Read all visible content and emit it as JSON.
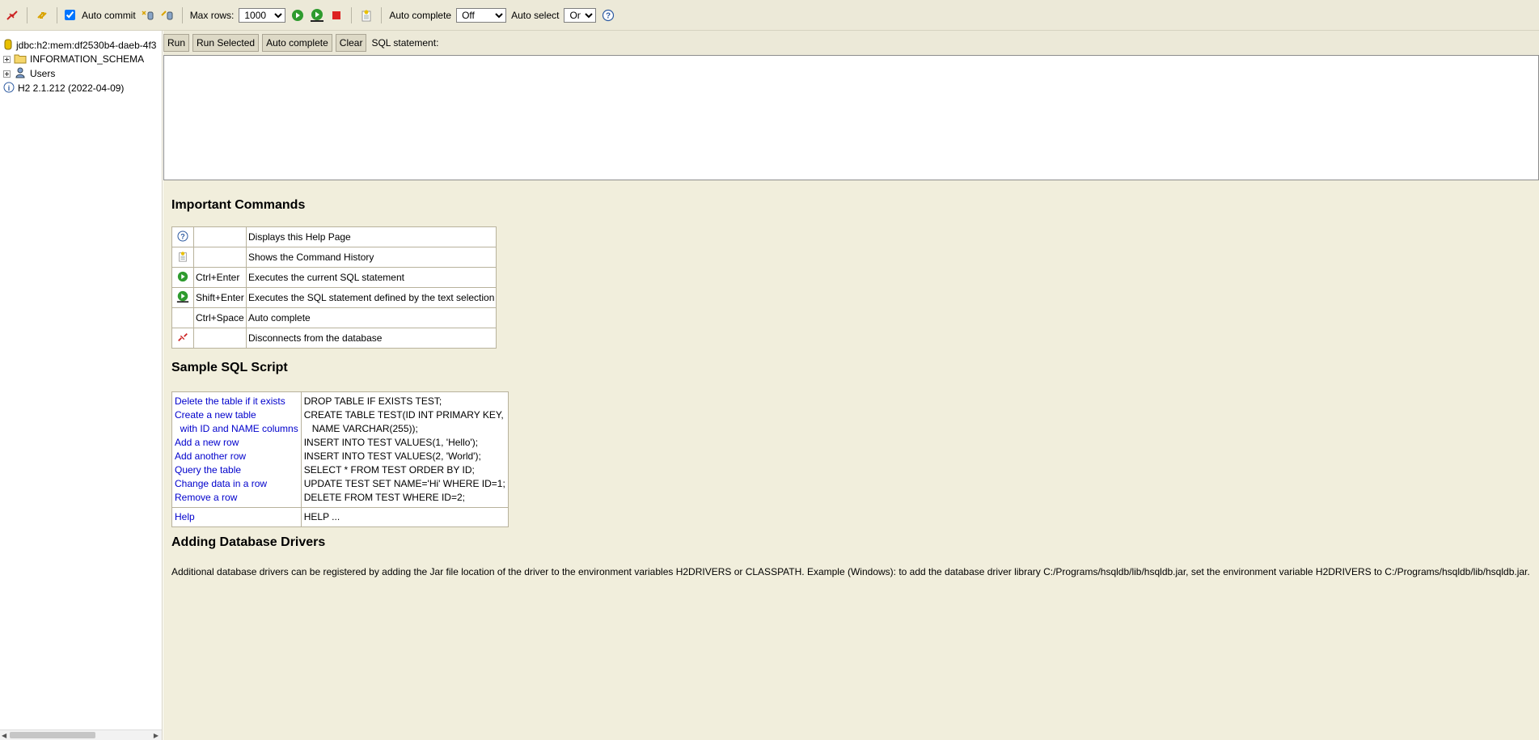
{
  "toolbar": {
    "auto_commit_label": "Auto commit",
    "max_rows_label": "Max rows:",
    "max_rows_value": "1000",
    "auto_complete_label": "Auto complete",
    "auto_complete_value": "Off",
    "auto_select_label": "Auto select",
    "auto_select_value": "On"
  },
  "tree": {
    "connection": "jdbc:h2:mem:df2530b4-daeb-4f3",
    "schema": "INFORMATION_SCHEMA",
    "users": "Users",
    "version": "H2 2.1.212 (2022-04-09)"
  },
  "sql": {
    "run_label": "Run",
    "run_selected_label": "Run Selected",
    "auto_complete_label": "Auto complete",
    "clear_label": "Clear",
    "statement_label": "SQL statement:",
    "statement_value": ""
  },
  "help": {
    "important_title": "Important Commands",
    "commands": [
      {
        "icon": "help-icon",
        "key": "",
        "desc": "Displays this Help Page"
      },
      {
        "icon": "history-icon",
        "key": "",
        "desc": "Shows the Command History"
      },
      {
        "icon": "run-icon",
        "key": "Ctrl+Enter",
        "desc": "Executes the current SQL statement"
      },
      {
        "icon": "run-selected-icon",
        "key": "Shift+Enter",
        "desc": "Executes the SQL statement defined by the text selection"
      },
      {
        "icon": "",
        "key": "Ctrl+Space",
        "desc": "Auto complete"
      },
      {
        "icon": "disconnect-icon",
        "key": "",
        "desc": "Disconnects from the database"
      }
    ],
    "sample_title": "Sample SQL Script",
    "samples": [
      {
        "label": "Delete the table if it exists",
        "code": "DROP TABLE IF EXISTS TEST;"
      },
      {
        "label": "Create a new table",
        "code": "CREATE TABLE TEST(ID INT PRIMARY KEY,"
      },
      {
        "label": "  with ID and NAME columns",
        "code": "   NAME VARCHAR(255));"
      },
      {
        "label": "Add a new row",
        "code": "INSERT INTO TEST VALUES(1, 'Hello');"
      },
      {
        "label": "Add another row",
        "code": "INSERT INTO TEST VALUES(2, 'World');"
      },
      {
        "label": "Query the table",
        "code": "SELECT * FROM TEST ORDER BY ID;"
      },
      {
        "label": "Change data in a row",
        "code": "UPDATE TEST SET NAME='Hi' WHERE ID=1;"
      },
      {
        "label": "Remove a row",
        "code": "DELETE FROM TEST WHERE ID=2;"
      }
    ],
    "help_row": {
      "label": "Help",
      "code": "HELP ..."
    },
    "drivers_title": "Adding Database Drivers",
    "drivers_text": "Additional database drivers can be registered by adding the Jar file location of the driver to the environment variables H2DRIVERS or CLASSPATH. Example (Windows): to add the database driver library C:/Programs/hsqldb/lib/hsqldb.jar, set the environment variable H2DRIVERS to C:/Programs/hsqldb/lib/hsqldb.jar."
  },
  "colors": {
    "toolbar_bg": "#ece9d8",
    "help_bg": "#f1eedc",
    "link": "#0000cc"
  }
}
